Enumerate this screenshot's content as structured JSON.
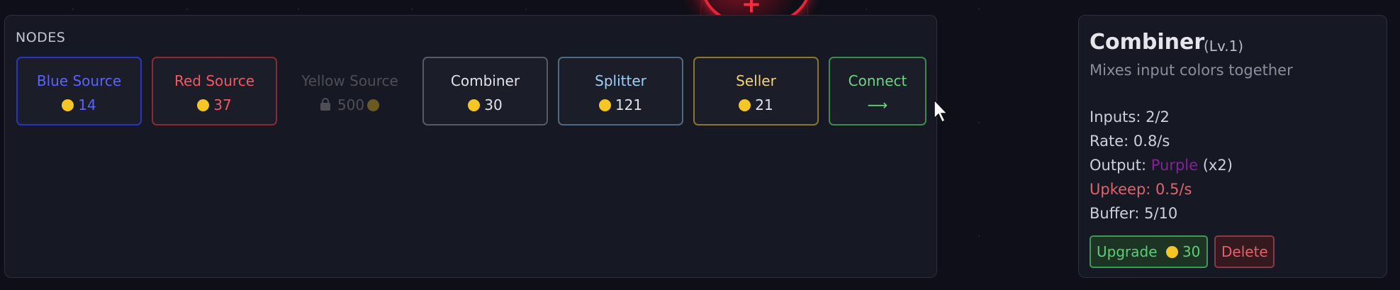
{
  "palette": {
    "title": "NODES",
    "nodes": [
      {
        "label": "Blue Source",
        "cost": "14",
        "state": "available",
        "color": "#5a63ff",
        "border": "#2b35c4",
        "cost_color": "#5a63ff"
      },
      {
        "label": "Red Source",
        "cost": "37",
        "state": "available",
        "color": "#f05a63",
        "border": "#8a2a33",
        "cost_color": "#f05a63"
      },
      {
        "label": "Yellow Source",
        "cost": "500",
        "state": "locked",
        "color": "#4e4f56",
        "border": "transparent",
        "cost_color": "#4e4f56"
      },
      {
        "label": "Combiner",
        "cost": "30",
        "state": "available",
        "color": "#e2e4ea",
        "border": "#555a68",
        "cost_color": "#e2e4ea"
      },
      {
        "label": "Splitter",
        "cost": "121",
        "state": "available",
        "color": "#9ecff6",
        "border": "#4d6a84",
        "cost_color": "#e2e4ea"
      },
      {
        "label": "Seller",
        "cost": "21",
        "state": "available",
        "color": "#f4d27a",
        "border": "#8a7432",
        "cost_color": "#e2e4ea"
      },
      {
        "label": "Connect",
        "cost": "⟶",
        "state": "tool",
        "color": "#6fd485",
        "border": "#3f8a50",
        "cost_color": "#6fd485"
      }
    ]
  },
  "info": {
    "title": "Combiner",
    "level": "(Lv.1)",
    "description": "Mixes input colors together",
    "inputs": "Inputs: 2/2",
    "rate": "Rate: 0.8/s",
    "output_label": "Output: ",
    "output_color": "Purple",
    "output_mult": " (x2)",
    "upkeep": "Upkeep: 0.5/s",
    "buffer": "Buffer: 5/10",
    "upgrade_label": "Upgrade",
    "upgrade_cost": "30",
    "delete_label": "Delete"
  },
  "colors": {
    "background": "#0e0f18",
    "panel": "#161824",
    "coin": "#f6c625",
    "glow_node": "#e8263a",
    "purple": "#8a1f9e"
  },
  "icons": [
    "coin-icon",
    "lock-icon",
    "arrow-right-icon",
    "plus-icon",
    "mouse-cursor-icon"
  ]
}
